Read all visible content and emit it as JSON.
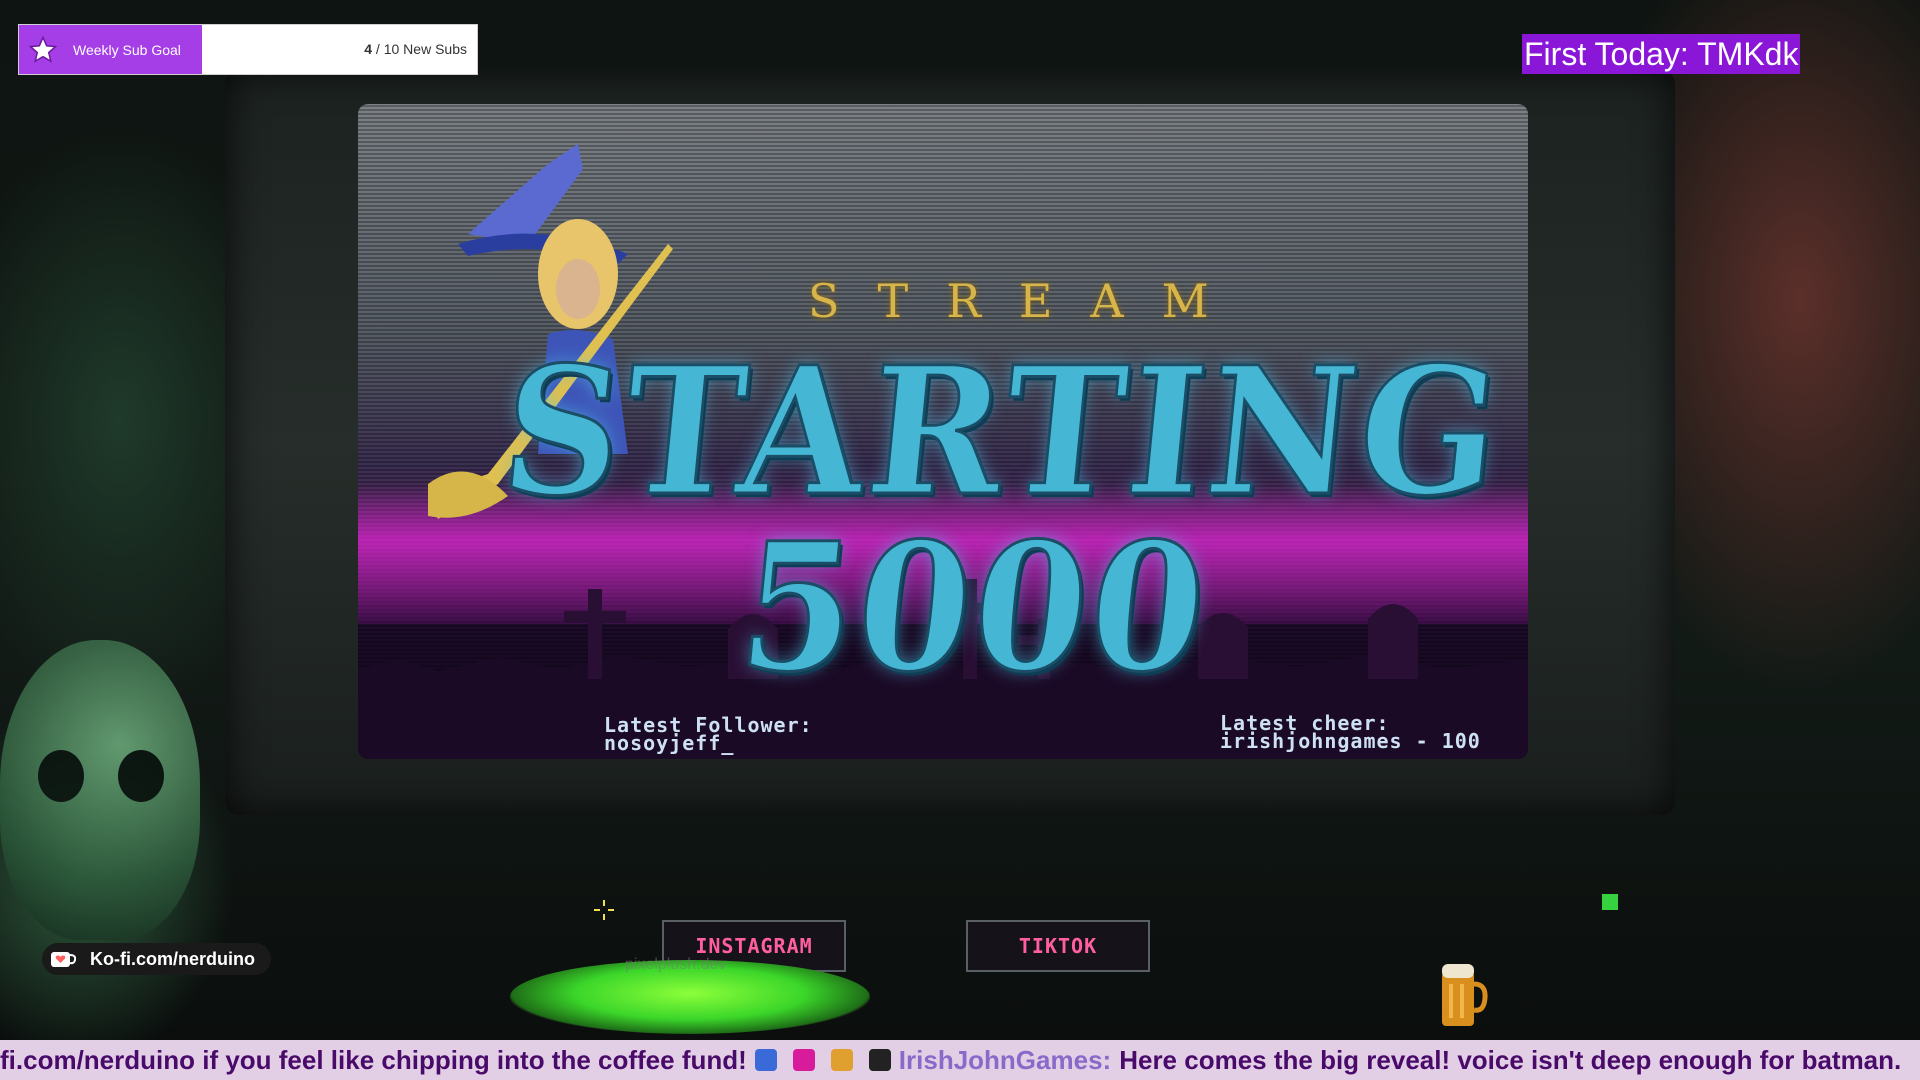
{
  "overlay": {
    "sub_goal": {
      "label": "Weekly Sub Goal",
      "current": "4",
      "separator": " / ",
      "target": "10 New Subs",
      "progress": 0.4,
      "icon": "star-icon"
    },
    "first_today": "First Today: TMKdk",
    "kofi": {
      "label": "Ko-fi.com/nerduino",
      "icon": "kofi-cup-icon"
    }
  },
  "screen": {
    "subtitle": "STREAM",
    "title": "STARTING 5000",
    "latest_follower_label": "Latest Follower:",
    "latest_follower": "nosoyjeff_",
    "latest_cheer_label": "Latest cheer:",
    "latest_cheer": "irishjohngames - 100"
  },
  "socials": {
    "instagram": "INSTAGRAM",
    "tiktok": "TIKTOK"
  },
  "cauldron_tag": "pixelplush.dev",
  "ticker": {
    "message_part": "fi.com/nerduino if you feel like chipping into the coffee fund!",
    "user": "IrishJohnGames:",
    "message": "Here comes the big reveal! voice isn't deep enough for batman."
  },
  "colors": {
    "accent_purple": "#8a17d8",
    "goal_fill": "#a53ee6",
    "title_cyan": "#45b7d4",
    "neon_magenta": "#e02ad8",
    "ticker_bg": "#e2cfe6",
    "ticker_text": "#4a0a6a"
  }
}
